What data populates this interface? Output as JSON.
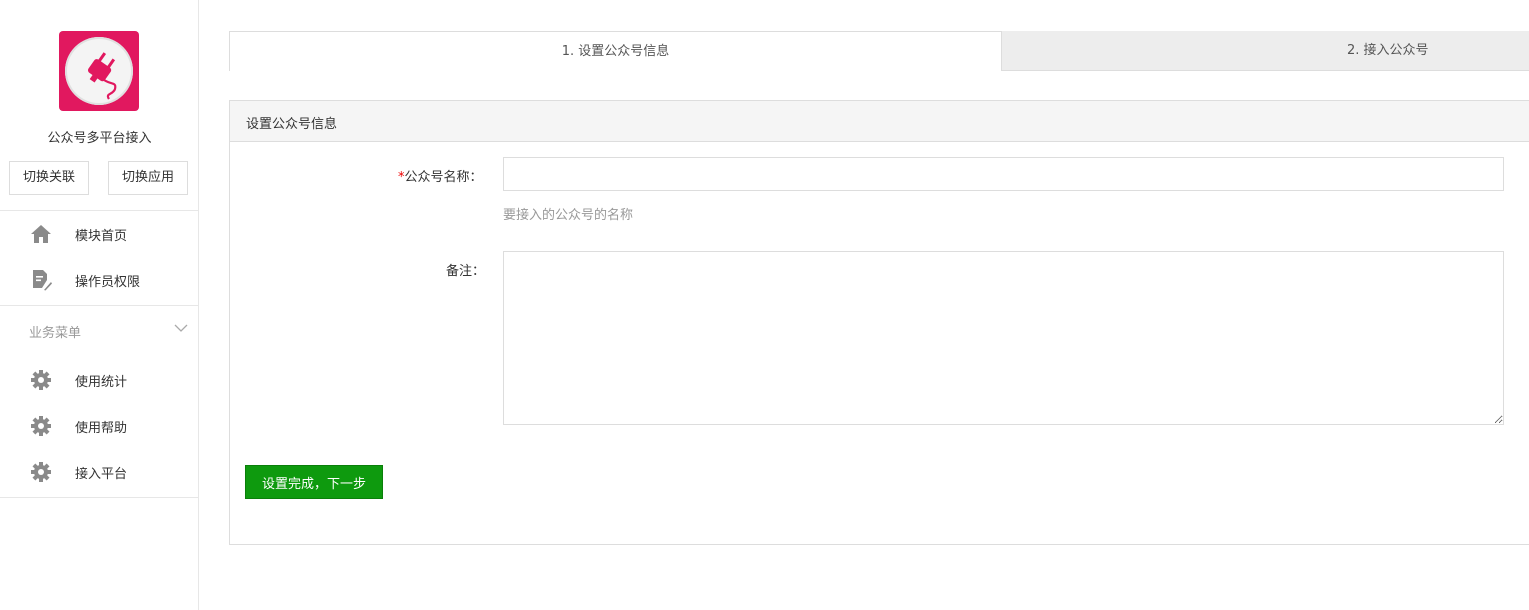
{
  "sidebar": {
    "app_logo_icon": "plug-icon",
    "app_name": "公众号多平台接入",
    "switch_link_label": "切换关联",
    "switch_app_label": "切换应用",
    "nav_items": [
      {
        "icon": "home-icon",
        "label": "模块首页"
      },
      {
        "icon": "edit-document-icon",
        "label": "操作员权限"
      }
    ],
    "business_menu": {
      "title": "业务菜单",
      "items": [
        {
          "icon": "gear-icon",
          "label": "使用统计"
        },
        {
          "icon": "gear-icon",
          "label": "使用帮助"
        },
        {
          "icon": "gear-icon",
          "label": "接入平台"
        }
      ]
    }
  },
  "steps": [
    {
      "label": "1. 设置公众号信息",
      "active": true
    },
    {
      "label": "2. 接入公众号",
      "active": false
    }
  ],
  "panel": {
    "title": "设置公众号信息",
    "name_field": {
      "required_mark": "*",
      "label": "公众号名称：",
      "value": "",
      "help": "要接入的公众号的名称"
    },
    "remark_field": {
      "label": "备注：",
      "value": ""
    },
    "submit_label": "设置完成，下一步"
  },
  "colors": {
    "logo_bg": "#e1185f",
    "primary_button": "#0e9a0e",
    "required": "#ee0000",
    "icon_gray": "#8a8a8a"
  }
}
